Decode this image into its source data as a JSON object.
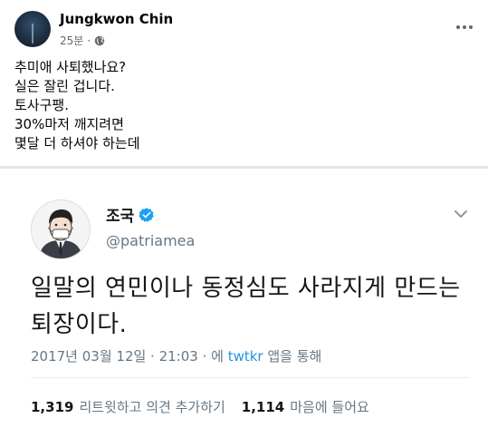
{
  "post": {
    "author": "Jungkwon Chin",
    "time": "25분",
    "visibility_icon": "globe-icon",
    "more_icon": "more-horizontal-icon",
    "lines": [
      "추미애 사퇴했나요?",
      "실은 잘린 겁니다.",
      "토사구팽.",
      "30%마저 깨지려면",
      "몇달 더 하셔야 하는데"
    ]
  },
  "tweet": {
    "name": "조국",
    "verified_icon": "verified-badge-icon",
    "handle": "@patriamea",
    "text_lines": [
      "일말의 연민이나 동정심도 사라지게 만드는",
      "퇴장이다."
    ],
    "timestamp": "2017년 03월 12일 · 21:03 · 에",
    "source_link": "twtkr",
    "source_suffix": "앱을 통해",
    "retweets_count": "1,319",
    "retweets_label": "리트윗하고 의견 추가하기",
    "likes_count": "1,114",
    "likes_label": "마음에 들어요",
    "colors": {
      "link": "#1b95e0",
      "verified": "#1da1f2"
    }
  }
}
